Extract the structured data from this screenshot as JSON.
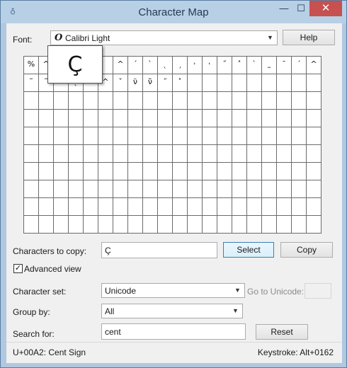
{
  "window": {
    "title": "Character Map",
    "controls": {
      "minimize": "—",
      "maximize": "☐",
      "close": "✕"
    }
  },
  "font": {
    "label": "Font:",
    "selected": "Calibri Light",
    "icon": "O",
    "help_label": "Help"
  },
  "grid": {
    "cells": [
      "%",
      "^",
      "",
      "",
      "",
      "",
      "^",
      "ˊ",
      "ˋ",
      "ˎ",
      "ˏ",
      "˒",
      "˓",
      "˝",
      "˟",
      "ˋ",
      "˷",
      "ˉ",
      "ˊ",
      "^",
      "˜",
      "˜",
      "",
      "ˎ",
      "ˊ",
      "^",
      "ˇ",
      "ν̈",
      "ν̃",
      "˝",
      "˟",
      "",
      "",
      "",
      "",
      "",
      "",
      "",
      "",
      ""
    ],
    "popup_char": "Ç"
  },
  "copy": {
    "label": "Characters to copy:",
    "value": "Ç",
    "select_label": "Select",
    "copy_label": "Copy"
  },
  "advanced": {
    "label": "Advanced view",
    "checked": true
  },
  "charset": {
    "label": "Character set:",
    "selected": "Unicode",
    "goto_label": "Go to Unicode:",
    "goto_value": ""
  },
  "groupby": {
    "label": "Group by:",
    "selected": "All"
  },
  "search": {
    "label": "Search for:",
    "value": "cent",
    "reset_label": "Reset"
  },
  "status": {
    "char_info": "U+00A2: Cent Sign",
    "keystroke": "Keystroke: Alt+0162"
  }
}
